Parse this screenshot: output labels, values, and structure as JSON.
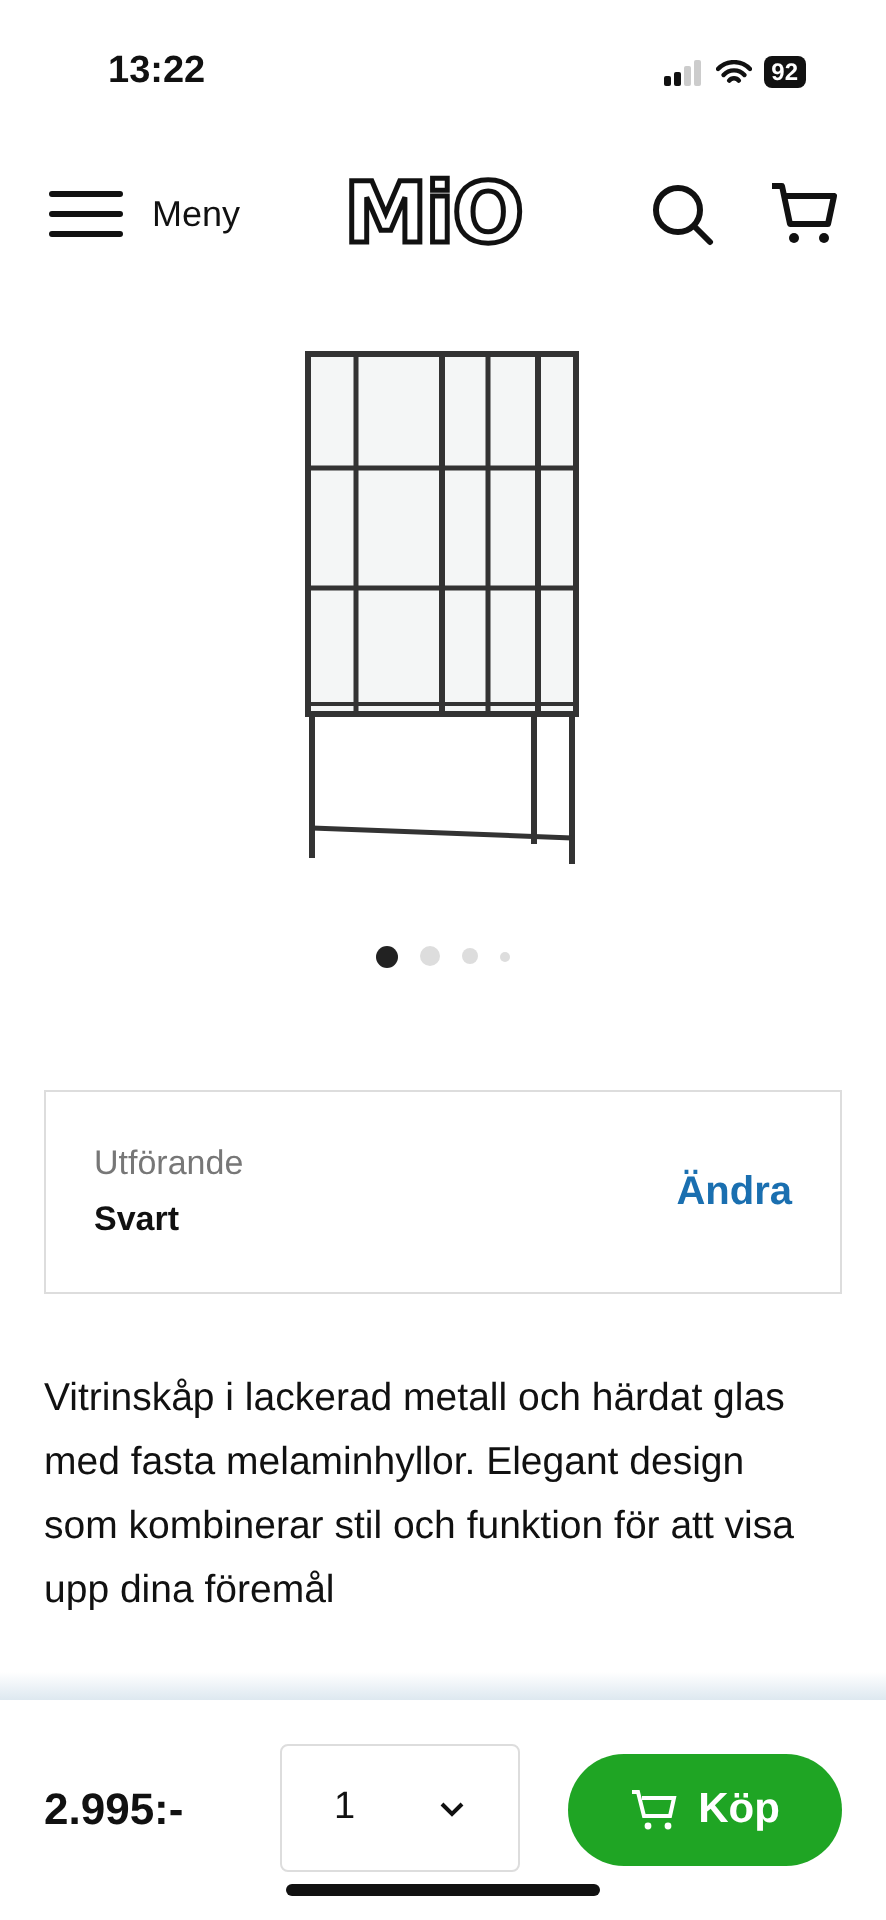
{
  "status_bar": {
    "time": "13:22",
    "battery": "92"
  },
  "header": {
    "menu_label": "Meny",
    "logo": "MiO"
  },
  "gallery": {
    "dots": [
      {
        "selected": true
      },
      {
        "selected": false
      },
      {
        "selected": false
      },
      {
        "selected": false
      }
    ]
  },
  "variant": {
    "label": "Utförande",
    "value": "Svart",
    "action": "Ändra"
  },
  "description": "Vitrinskåp i lackerad metall och härdat glas med fasta melaminhyllor. Elegant design som kombinerar stil och funktion för att visa upp dina föremål",
  "buy_bar": {
    "price": "2.995:-",
    "quantity": "1",
    "buy_label": "Köp"
  }
}
